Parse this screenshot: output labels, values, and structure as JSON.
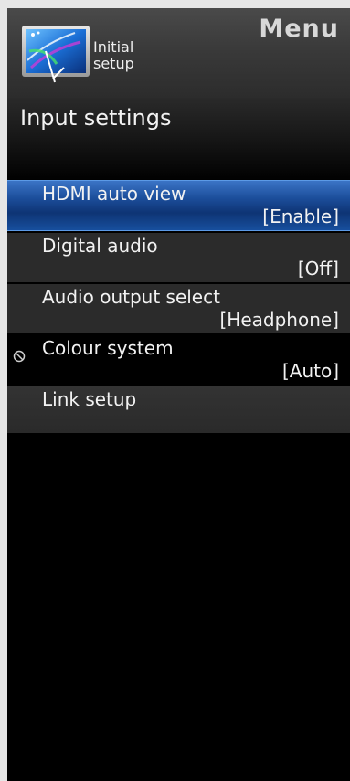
{
  "header": {
    "menu_title": "Menu",
    "category_line1": "Initial",
    "category_line2": "setup",
    "logo_icon": "initial-setup-icon"
  },
  "section": {
    "title": "Input settings"
  },
  "items": [
    {
      "label": "HDMI auto view",
      "value": "[Enable]",
      "selected": true
    },
    {
      "label": "Digital audio",
      "value": "[Off]"
    },
    {
      "label": "Audio output select",
      "value": "[Headphone]"
    },
    {
      "label": "Colour system",
      "value": "[Auto]",
      "disabled_icon": "prohibited-icon"
    },
    {
      "label": "Link setup",
      "value": ""
    }
  ],
  "colors": {
    "selected_bar": "#1c4e9b",
    "item_bg": "#2b2b2b",
    "panel_bg": "#000000"
  }
}
